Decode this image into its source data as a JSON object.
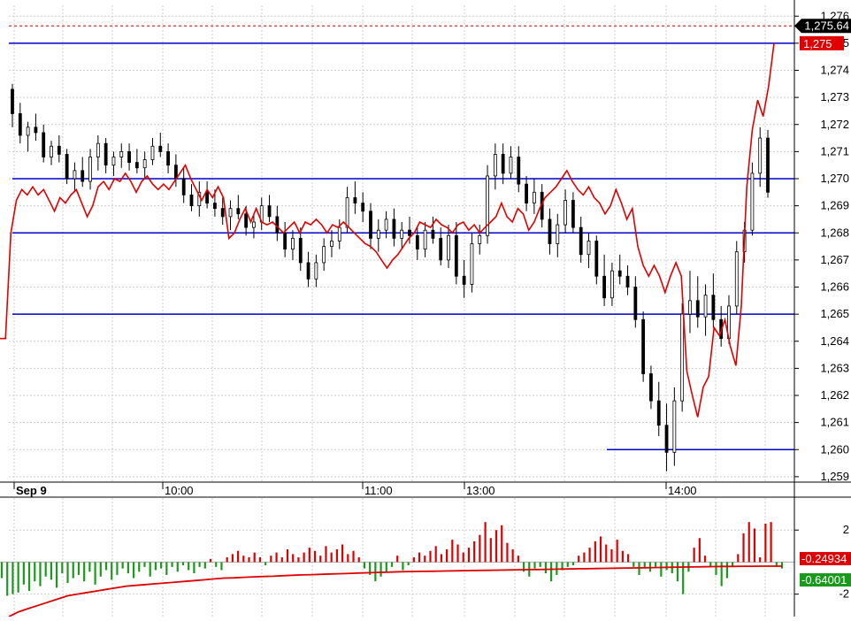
{
  "chart_data": [
    {
      "type": "line",
      "subtype": "candlestick-with-line",
      "title": "",
      "xlabel": "",
      "ylabel": "",
      "ylim": [
        1258.8,
        1276.4
      ],
      "y_ticks": [
        "1,276",
        "1,275",
        "1,274",
        "1,273",
        "1,272",
        "1,271",
        "1,270",
        "1,269",
        "1,268",
        "1,267",
        "1,266",
        "1,265",
        "1,264",
        "1,263",
        "1,262",
        "1,261",
        "1,260",
        "1,259"
      ],
      "x_labels": [
        "Sep 9",
        "10:00",
        "11:00",
        "13:00",
        "14:00"
      ],
      "grid": true,
      "horizontal_lines": [
        1275.0,
        1270.0,
        1268.0,
        1265.0,
        1260.0
      ],
      "last_price_label": "1,275.64",
      "current_price_label": "1,275",
      "series": [
        {
          "color": "#e00000",
          "values": [
            1264.1,
            1264.1,
            1268.0,
            1269.2,
            1269.6,
            1269.4,
            1269.7,
            1269.4,
            1269.6,
            1269.2,
            1268.8,
            1269.3,
            1269.1,
            1269.4,
            1269.6,
            1269.1,
            1268.6,
            1269.0,
            1269.7,
            1269.9,
            1269.6,
            1270.0,
            1269.9,
            1270.2,
            1269.9,
            1269.5,
            1269.9,
            1270.1,
            1269.8,
            1269.6,
            1269.8,
            1269.6,
            1269.9,
            1270.2,
            1270.5,
            1270.0,
            1269.6,
            1269.2,
            1269.6,
            1269.3,
            1269.7,
            1269.3,
            1267.8,
            1268.0,
            1268.5,
            1268.9,
            1268.4,
            1268.9,
            1268.4,
            1268.3,
            1268.4,
            1268.2,
            1268.0,
            1268.2,
            1268.4,
            1268.0,
            1268.4,
            1268.3,
            1268.5,
            1268.3,
            1268.0,
            1268.3,
            1268.2,
            1268.4,
            1268.2,
            1268.0,
            1267.8,
            1267.6,
            1267.5,
            1267.3,
            1267.0,
            1266.7,
            1267.0,
            1267.2,
            1267.5,
            1267.8,
            1268.0,
            1268.4,
            1268.3,
            1268.2,
            1268.5,
            1268.3,
            1268.2,
            1268.0,
            1268.3,
            1268.4,
            1268.1,
            1268.3,
            1268.0,
            1268.2,
            1268.4,
            1268.6,
            1269.1,
            1268.6,
            1268.4,
            1268.9,
            1268.7,
            1268.1,
            1268.4,
            1268.9,
            1269.3,
            1269.5,
            1269.7,
            1270.0,
            1270.3,
            1269.9,
            1269.6,
            1269.4,
            1269.7,
            1269.3,
            1269.1,
            1268.7,
            1269.0,
            1269.6,
            1269.1,
            1268.5,
            1268.9,
            1267.5,
            1266.8,
            1266.4,
            1266.8,
            1266.4,
            1265.8,
            1266.4,
            1266.9,
            1266.4,
            1262.9,
            1262.0,
            1261.2,
            1262.3,
            1262.7,
            1264.5,
            1264.2,
            1264.8,
            1263.8,
            1263.1,
            1265.3,
            1269.7,
            1271.8,
            1272.9,
            1272.3,
            1273.4,
            1275.0
          ]
        }
      ],
      "candles_ohlc": [
        [
          1273.3,
          1273.5,
          1271.9,
          1272.4
        ],
        [
          1272.4,
          1272.8,
          1271.3,
          1271.6
        ],
        [
          1271.6,
          1272.1,
          1271.0,
          1271.9
        ],
        [
          1271.9,
          1272.4,
          1271.4,
          1271.7
        ],
        [
          1271.7,
          1272.0,
          1270.6,
          1270.8
        ],
        [
          1270.8,
          1271.4,
          1270.5,
          1271.2
        ],
        [
          1271.2,
          1271.6,
          1270.6,
          1270.9
        ],
        [
          1270.9,
          1271.1,
          1269.8,
          1270.0
        ],
        [
          1270.0,
          1270.6,
          1269.5,
          1270.3
        ],
        [
          1270.3,
          1270.8,
          1269.7,
          1269.9
        ],
        [
          1269.9,
          1271.1,
          1269.6,
          1270.8
        ],
        [
          1270.8,
          1271.6,
          1270.3,
          1271.3
        ],
        [
          1271.3,
          1271.5,
          1270.2,
          1270.5
        ],
        [
          1270.5,
          1271.0,
          1270.1,
          1270.8
        ],
        [
          1270.8,
          1271.3,
          1270.4,
          1271.0
        ],
        [
          1271.0,
          1271.3,
          1270.3,
          1270.6
        ],
        [
          1270.6,
          1271.1,
          1270.2,
          1270.4
        ],
        [
          1270.4,
          1271.0,
          1270.0,
          1270.7
        ],
        [
          1270.7,
          1271.5,
          1270.5,
          1271.2
        ],
        [
          1271.2,
          1271.7,
          1270.8,
          1271.0
        ],
        [
          1271.0,
          1271.3,
          1270.2,
          1270.5
        ],
        [
          1270.5,
          1270.9,
          1269.7,
          1270.0
        ],
        [
          1270.0,
          1270.4,
          1269.1,
          1269.4
        ],
        [
          1269.4,
          1269.8,
          1268.8,
          1269.0
        ],
        [
          1269.0,
          1269.9,
          1268.6,
          1269.5
        ],
        [
          1269.5,
          1269.9,
          1268.9,
          1269.1
        ],
        [
          1269.1,
          1269.6,
          1268.6,
          1268.9
        ],
        [
          1268.9,
          1269.3,
          1268.3,
          1268.6
        ],
        [
          1268.6,
          1269.2,
          1268.1,
          1268.9
        ],
        [
          1268.9,
          1269.4,
          1268.5,
          1268.7
        ],
        [
          1268.7,
          1269.0,
          1267.9,
          1268.2
        ],
        [
          1268.2,
          1268.7,
          1267.8,
          1268.4
        ],
        [
          1268.4,
          1269.3,
          1268.1,
          1269.0
        ],
        [
          1269.0,
          1269.4,
          1268.4,
          1268.6
        ],
        [
          1268.6,
          1269.0,
          1267.7,
          1268.0
        ],
        [
          1268.0,
          1268.4,
          1267.1,
          1267.4
        ],
        [
          1267.4,
          1268.1,
          1267.0,
          1267.8
        ],
        [
          1267.8,
          1268.2,
          1266.6,
          1266.9
        ],
        [
          1266.9,
          1267.3,
          1266.0,
          1266.3
        ],
        [
          1266.3,
          1267.2,
          1266.0,
          1266.9
        ],
        [
          1266.9,
          1267.8,
          1266.6,
          1267.5
        ],
        [
          1267.5,
          1268.1,
          1267.1,
          1267.7
        ],
        [
          1267.7,
          1268.5,
          1267.4,
          1268.2
        ],
        [
          1268.2,
          1269.7,
          1268.0,
          1269.3
        ],
        [
          1269.3,
          1269.9,
          1268.7,
          1269.1
        ],
        [
          1269.1,
          1269.5,
          1268.4,
          1268.8
        ],
        [
          1268.8,
          1269.1,
          1267.4,
          1267.8
        ],
        [
          1267.8,
          1268.5,
          1267.3,
          1268.1
        ],
        [
          1268.1,
          1268.8,
          1267.8,
          1268.5
        ],
        [
          1268.5,
          1268.9,
          1267.5,
          1267.8
        ],
        [
          1267.8,
          1268.4,
          1267.4,
          1268.1
        ],
        [
          1268.1,
          1268.6,
          1267.6,
          1267.9
        ],
        [
          1267.9,
          1268.2,
          1267.0,
          1267.4
        ],
        [
          1267.4,
          1268.4,
          1267.1,
          1268.1
        ],
        [
          1268.1,
          1268.6,
          1267.6,
          1267.8
        ],
        [
          1267.8,
          1268.2,
          1266.8,
          1267.0
        ],
        [
          1267.0,
          1268.3,
          1266.7,
          1267.9
        ],
        [
          1267.9,
          1268.4,
          1266.1,
          1266.4
        ],
        [
          1266.4,
          1267.0,
          1265.6,
          1266.1
        ],
        [
          1266.1,
          1268.0,
          1265.8,
          1267.6
        ],
        [
          1267.6,
          1268.3,
          1267.2,
          1267.9
        ],
        [
          1267.9,
          1270.5,
          1267.6,
          1270.1
        ],
        [
          1270.1,
          1271.3,
          1269.6,
          1270.9
        ],
        [
          1270.9,
          1271.3,
          1269.8,
          1270.2
        ],
        [
          1270.2,
          1271.2,
          1270.0,
          1270.8
        ],
        [
          1270.8,
          1271.2,
          1269.5,
          1269.8
        ],
        [
          1269.8,
          1270.1,
          1268.8,
          1269.1
        ],
        [
          1269.1,
          1270.0,
          1268.7,
          1269.5
        ],
        [
          1269.5,
          1269.8,
          1268.2,
          1268.5
        ],
        [
          1268.5,
          1268.9,
          1267.2,
          1267.6
        ],
        [
          1267.6,
          1268.7,
          1267.1,
          1268.3
        ],
        [
          1268.3,
          1269.6,
          1268.0,
          1269.2
        ],
        [
          1269.2,
          1269.5,
          1268.0,
          1268.2
        ],
        [
          1268.2,
          1268.6,
          1266.9,
          1267.2
        ],
        [
          1267.2,
          1268.0,
          1266.7,
          1267.7
        ],
        [
          1267.7,
          1267.9,
          1266.1,
          1266.4
        ],
        [
          1266.4,
          1267.2,
          1265.3,
          1265.6
        ],
        [
          1265.6,
          1266.9,
          1265.3,
          1266.6
        ],
        [
          1266.6,
          1267.2,
          1266.1,
          1266.4
        ],
        [
          1266.4,
          1266.8,
          1265.7,
          1266.0
        ],
        [
          1266.0,
          1266.4,
          1264.5,
          1264.8
        ],
        [
          1264.8,
          1265.1,
          1262.5,
          1262.8
        ],
        [
          1262.8,
          1263.1,
          1261.5,
          1261.8
        ],
        [
          1261.8,
          1262.5,
          1260.5,
          1260.9
        ],
        [
          1260.9,
          1261.7,
          1259.2,
          1259.9
        ],
        [
          1259.9,
          1262.3,
          1259.4,
          1261.8
        ],
        [
          1261.8,
          1265.4,
          1261.4,
          1265.0
        ],
        [
          1265.0,
          1266.6,
          1264.3,
          1265.5
        ],
        [
          1265.5,
          1266.4,
          1264.5,
          1264.9
        ],
        [
          1264.9,
          1266.1,
          1264.2,
          1265.7
        ],
        [
          1265.7,
          1266.5,
          1264.5,
          1264.8
        ],
        [
          1264.8,
          1265.3,
          1263.8,
          1264.1
        ],
        [
          1264.1,
          1265.7,
          1263.9,
          1265.3
        ],
        [
          1265.3,
          1267.7,
          1265.0,
          1267.3
        ],
        [
          1267.3,
          1268.4,
          1266.9,
          1268.1
        ],
        [
          1268.1,
          1270.6,
          1267.9,
          1270.2
        ],
        [
          1270.2,
          1271.9,
          1269.7,
          1271.5
        ],
        [
          1271.5,
          1271.8,
          1269.3,
          1269.5
        ]
      ]
    },
    {
      "type": "bar",
      "subtype": "histogram-with-line",
      "ylim": [
        -3.4,
        4.0
      ],
      "y_ticks": [
        "2",
        "-2"
      ],
      "indicator_labels": [
        "-0.24934",
        "-0.64001"
      ],
      "series": [
        {
          "color": "#e00000",
          "values": [
            -1.0,
            -2.1,
            -2.0,
            -1.9,
            -1.4,
            -1.8,
            -1.2,
            -1.5,
            -0.9,
            -1.1,
            -1.6,
            -0.7,
            -1.3,
            -1.0,
            -0.8,
            -1.2,
            -0.6,
            -1.4,
            -0.9,
            -0.5,
            -1.1,
            -0.8,
            -0.4,
            -0.7,
            -1.0,
            -0.6,
            -0.3,
            -0.9,
            -0.5,
            -0.4,
            -0.8,
            -0.3,
            -0.6,
            -0.2,
            -0.5,
            -0.7,
            -0.3,
            -0.4,
            0.2,
            -0.3,
            -0.5,
            0.3,
            0.5,
            0.7,
            0.4,
            0.3,
            0.6,
            0.3,
            -0.2,
            0.4,
            0.6,
            0.3,
            0.8,
            0.5,
            0.3,
            0.6,
            0.9,
            0.7,
            0.4,
            1.0,
            0.6,
            0.8,
            1.1,
            0.5,
            0.7,
            0.3,
            -0.4,
            -0.8,
            -1.2,
            -0.9,
            -0.6,
            -0.3,
            0.4,
            -0.5,
            -0.2,
            0.3,
            0.6,
            0.4,
            0.7,
            1.0,
            0.5,
            0.8,
            1.4,
            1.1,
            0.6,
            0.9,
            1.3,
            1.7,
            2.5,
            1.5,
            2.0,
            2.3,
            1.2,
            0.8,
            0.4,
            -0.6,
            -0.9,
            -0.4,
            -0.3,
            -0.7,
            -1.2,
            -0.8,
            -0.5,
            -0.3,
            -0.2,
            0.4,
            0.6,
            0.9,
            1.3,
            1.6,
            1.1,
            0.8,
            1.4,
            0.7,
            0.5,
            -0.3,
            -0.8,
            -0.4,
            -0.6,
            -0.3,
            -0.9,
            -0.5,
            -0.7,
            -1.2,
            -2.0,
            -0.6,
            0.9,
            1.5,
            0.4,
            -0.3,
            -0.8,
            -1.5,
            -1.0,
            -0.3,
            0.5,
            1.8,
            2.5,
            2.1,
            0.3,
            2.4,
            2.5,
            -0.3,
            -0.4
          ]
        },
        {
          "color": "#e00000",
          "values": [
            -3.4,
            -3.1,
            -2.9,
            -2.7,
            -2.5,
            -2.3,
            -2.1,
            -2.0,
            -1.9,
            -1.8,
            -1.7,
            -1.6,
            -1.5,
            -1.45,
            -1.4,
            -1.35,
            -1.3,
            -1.25,
            -1.2,
            -1.15,
            -1.1,
            -1.05,
            -1.0,
            -0.98,
            -0.95,
            -0.92,
            -0.9,
            -0.88,
            -0.85,
            -0.82,
            -0.8,
            -0.78,
            -0.76,
            -0.74,
            -0.72,
            -0.7,
            -0.68,
            -0.66,
            -0.64,
            -0.62,
            -0.6,
            -0.59,
            -0.58,
            -0.57,
            -0.56,
            -0.55,
            -0.54,
            -0.53,
            -0.52,
            -0.51,
            -0.5,
            -0.49,
            -0.48,
            -0.47,
            -0.46,
            -0.45,
            -0.44,
            -0.43,
            -0.42,
            -0.41,
            -0.4,
            -0.39,
            -0.38,
            -0.37,
            -0.36,
            -0.35,
            -0.34,
            -0.33,
            -0.32,
            -0.31,
            -0.3,
            -0.29,
            -0.28,
            -0.27,
            -0.27,
            -0.26,
            -0.26,
            -0.25,
            -0.25,
            -0.25
          ]
        }
      ]
    }
  ]
}
